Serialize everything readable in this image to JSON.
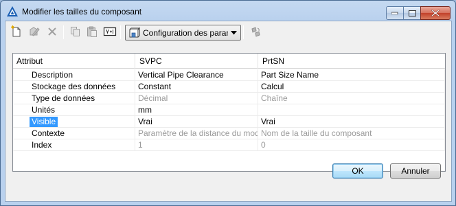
{
  "window": {
    "title": "Modifier les tailles du composant"
  },
  "toolbar": {
    "buttons": [
      {
        "icon": "new-icon",
        "enabled": true
      },
      {
        "icon": "edit-icon",
        "enabled": false
      },
      {
        "icon": "delete-icon",
        "enabled": false
      },
      {
        "icon": "copy-icon",
        "enabled": false
      },
      {
        "icon": "paste-icon",
        "enabled": false
      },
      {
        "icon": "rename-icon",
        "enabled": true
      },
      {
        "icon": "refresh-icon",
        "enabled": false
      }
    ],
    "config_dropdown": {
      "label": "Configuration des paran"
    }
  },
  "table": {
    "headers": [
      "Attribut",
      "SVPC",
      "PrtSN"
    ],
    "rows": [
      {
        "attribute": "Description",
        "svpc": "Vertical Pipe Clearance",
        "prtsn": "Part Size Name",
        "svpc_disabled": false,
        "prtsn_disabled": false
      },
      {
        "attribute": "Stockage des données",
        "svpc": "Constant",
        "prtsn": "Calcul",
        "svpc_disabled": false,
        "prtsn_disabled": false
      },
      {
        "attribute": "Type de données",
        "svpc": "Décimal",
        "prtsn": "Chaîne",
        "svpc_disabled": true,
        "prtsn_disabled": true
      },
      {
        "attribute": "Unités",
        "svpc": "mm",
        "prtsn": "",
        "svpc_disabled": false,
        "prtsn_disabled": false
      },
      {
        "attribute": "Visible",
        "svpc": "Vrai",
        "prtsn": "Vrai",
        "svpc_disabled": false,
        "prtsn_disabled": false,
        "selected": true
      },
      {
        "attribute": "Contexte",
        "svpc": "Paramètre de la distance du modèle",
        "prtsn": "Nom de la taille du composant",
        "svpc_disabled": true,
        "prtsn_disabled": true
      },
      {
        "attribute": "Index",
        "svpc": "1",
        "prtsn": "0",
        "svpc_disabled": true,
        "prtsn_disabled": true
      }
    ]
  },
  "buttons": {
    "ok": "OK",
    "cancel": "Annuler"
  },
  "colors": {
    "selection": "#3399ff",
    "disabled_text": "#9a9a9a"
  }
}
